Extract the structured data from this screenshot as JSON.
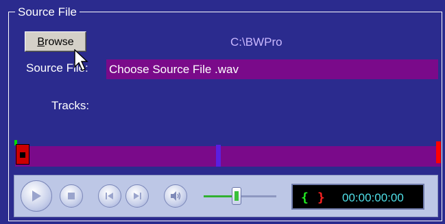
{
  "group": {
    "title": "Source File"
  },
  "browse": {
    "label": "Browse"
  },
  "path": {
    "text": "C:\\BWPro"
  },
  "source": {
    "label": "Source File:",
    "value": "Choose Source File .wav"
  },
  "tracks": {
    "label": "Tracks:"
  },
  "transport": {
    "time": "00:00:00:00",
    "brace_left": "{",
    "brace_right": "}",
    "volume_level": 0.45,
    "buttons": [
      "play-icon",
      "stop-icon",
      "previous-icon",
      "next-icon",
      "speaker-icon"
    ]
  },
  "colors": {
    "background": "#2b2b8e",
    "field": "#7a0a8a",
    "path_text": "#c9b8ff",
    "time_text": "#4fe0e8",
    "marker_start": "#cc0000",
    "marker_end": "#ff0000",
    "cursor_marker": "#5a1fe0"
  }
}
